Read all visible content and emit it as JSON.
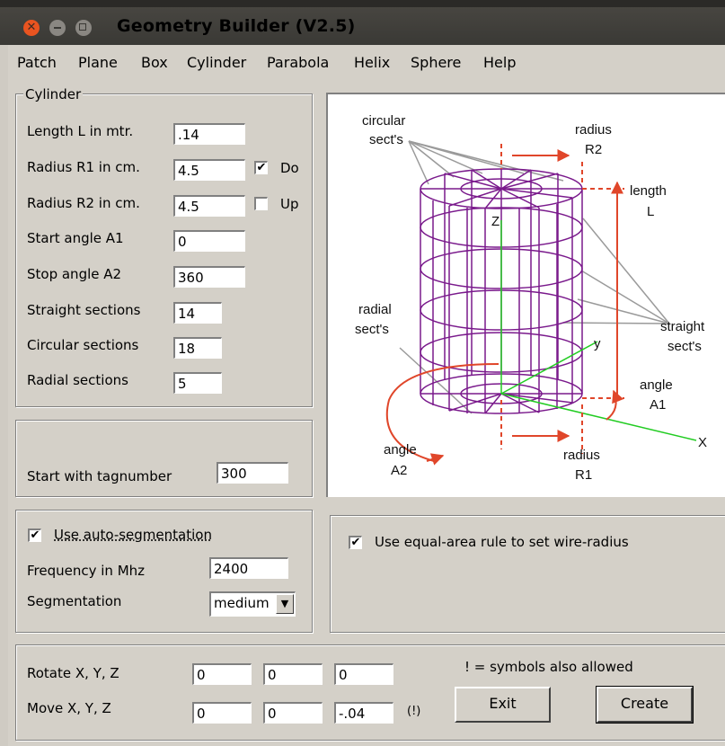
{
  "window": {
    "title": "Geometry Builder (V2.5)"
  },
  "menu": [
    "Patch",
    "Plane",
    "Box",
    "Cylinder",
    "Parabola",
    "Helix",
    "Sphere",
    "Help"
  ],
  "cylinder_group": {
    "legend": "Cylinder",
    "fields": [
      {
        "label": "Length L in mtr.",
        "value": ".14"
      },
      {
        "label": "Radius R1 in cm.",
        "value": "4.5"
      },
      {
        "label": "Radius R2 in cm.",
        "value": "4.5"
      },
      {
        "label": "Start angle A1",
        "value": "0"
      },
      {
        "label": "Stop angle A2",
        "value": "360"
      },
      {
        "label": "Straight sections",
        "value": "14"
      },
      {
        "label": "Circular sections",
        "value": "18"
      },
      {
        "label": "Radial sections",
        "value": "5"
      }
    ],
    "do_checkbox": {
      "label": "Do",
      "checked": true
    },
    "up_checkbox": {
      "label": "Up",
      "checked": false
    }
  },
  "tag_group": {
    "label": "Start with tagnumber",
    "value": "300"
  },
  "segmentation_group": {
    "auto_label": "Use auto-segmentation",
    "auto_checked": true,
    "frequency_label": "Frequency in Mhz",
    "frequency_value": "2400",
    "segmentation_label": "Segmentation",
    "segmentation_value": "medium"
  },
  "wire_group": {
    "label": "Use equal-area rule to set wire-radius",
    "checked": true
  },
  "transform": {
    "rotate_label": "Rotate X, Y, Z",
    "rotate_values": [
      "0",
      "0",
      "0"
    ],
    "move_label": "Move X, Y, Z",
    "move_values": [
      "0",
      "0",
      "-.04"
    ],
    "note_marker": "(!)",
    "symbols_note": "! =  symbols also allowed"
  },
  "buttons": {
    "exit": "Exit",
    "create": "Create"
  },
  "diagram_labels": {
    "circular": [
      "circular",
      "sect's"
    ],
    "radius_r2": [
      "radius",
      "R2"
    ],
    "length": [
      "length",
      "L"
    ],
    "z_axis": "Z",
    "radial": [
      "radial",
      "sect's"
    ],
    "y_axis": "y",
    "straight": [
      "straight",
      "sect's"
    ],
    "angle_a1": [
      "angle",
      "A1"
    ],
    "x_axis": "X",
    "angle_a2": [
      "angle",
      "A2"
    ],
    "radius_r1": [
      "radius",
      "R1"
    ]
  },
  "colors": {
    "titlebar": "#3c3b37",
    "close": "#e95420",
    "wire": "#7a1a8c",
    "arrow": "#e0462a",
    "axis": "#22cc22"
  }
}
